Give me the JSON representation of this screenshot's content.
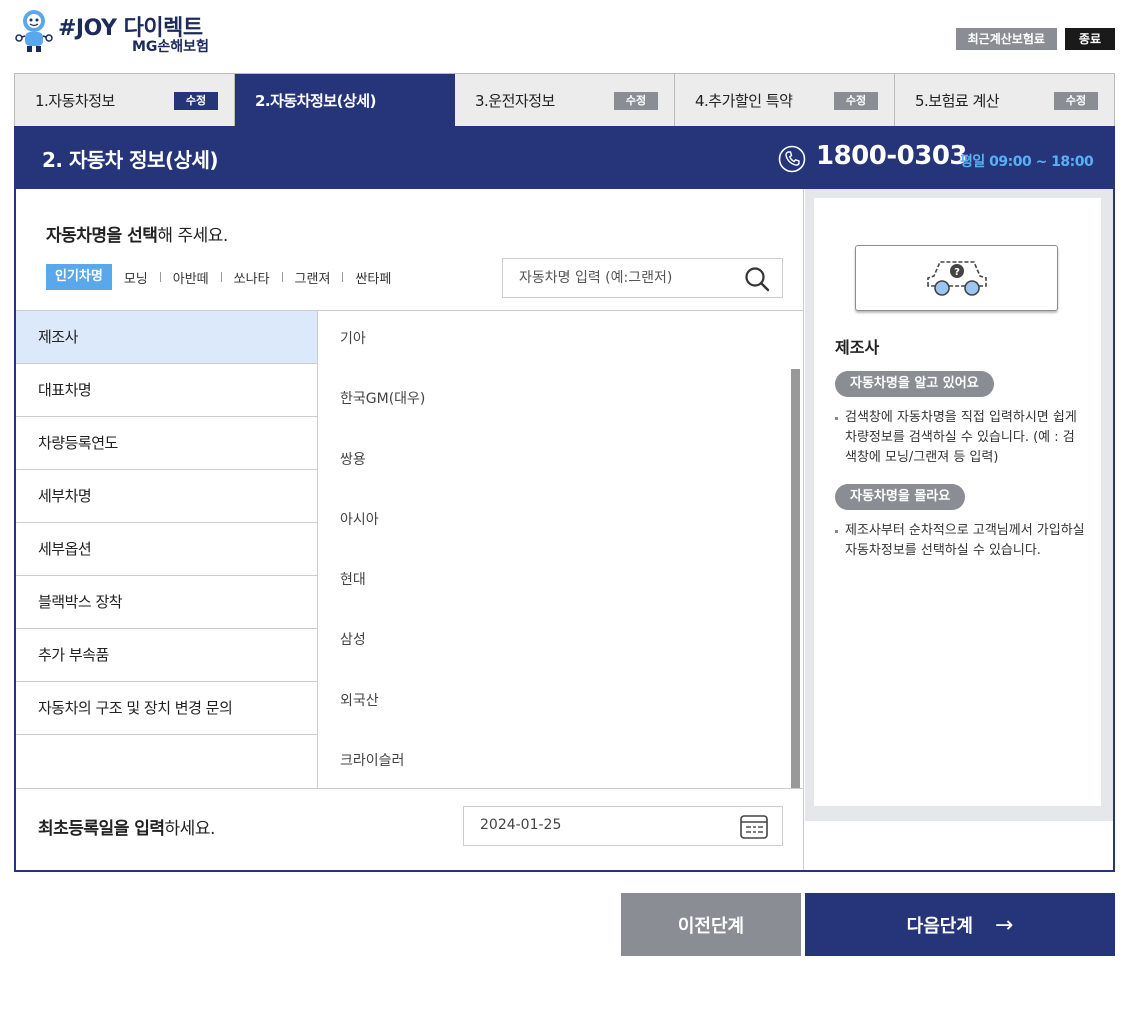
{
  "header": {
    "brand": "#JOY 다이렉트",
    "sub": "MG손해보험",
    "recent_label": "최근계산보험료",
    "exit_label": "종료"
  },
  "steps": [
    {
      "label": "1.자동차정보",
      "edit": "수정",
      "active": false
    },
    {
      "label": "2.자동차정보(상세)",
      "edit": "",
      "active": true
    },
    {
      "label": "3.운전자정보",
      "edit": "수정",
      "active": false
    },
    {
      "label": "4.추가할인 특약",
      "edit": "수정",
      "active": false
    },
    {
      "label": "5.보험료 계산",
      "edit": "수정",
      "active": false
    }
  ],
  "section": {
    "title": "2. 자동차 정보(상세)",
    "phone": "1800-0303",
    "hours": "평일 09:00 ~ 18:00"
  },
  "question": {
    "bold": "자동차명을 선택",
    "rest": "해 주세요."
  },
  "quick": {
    "popular": "인기차명",
    "cars": [
      "모닝",
      "아반떼",
      "쏘나타",
      "그랜져",
      "싼타페"
    ]
  },
  "search": {
    "placeholder": "자동차명 입력 (예:그랜저)"
  },
  "categories": [
    "제조사",
    "대표차명",
    "차량등록연도",
    "세부차명",
    "세부옵션",
    "블랙박스 장착",
    "추가 부속품",
    "자동차의 구조 및 장치 변경 문의"
  ],
  "makers": [
    "기아",
    "한국GM(대우)",
    "쌍용",
    "아시아",
    "현대",
    "삼성",
    "외국산",
    "크라이슬러"
  ],
  "registration": {
    "bold": "최초등록일을 입력",
    "rest": "하세요.",
    "date": "2024-01-25"
  },
  "help": {
    "heading": "제조사",
    "pill1": "자동차명을 알고 있어요",
    "desc1": "검색창에 자동차명을 직접 입력하시면 쉽게 차량정보를 검색하실 수 있습니다. (예 : 검색창에 모닝/그랜져 등 입력)",
    "pill2": "자동차명을 몰라요",
    "desc2": "제조사부터 순차적으로 고객님께서 가입하실 자동차정보를 선택하실 수 있습니다."
  },
  "buttons": {
    "prev": "이전단계",
    "next": "다음단계"
  },
  "colors": {
    "brand_navy": "#26357a",
    "accent_blue": "#5aa8ec",
    "gray": "#8a8d94"
  }
}
